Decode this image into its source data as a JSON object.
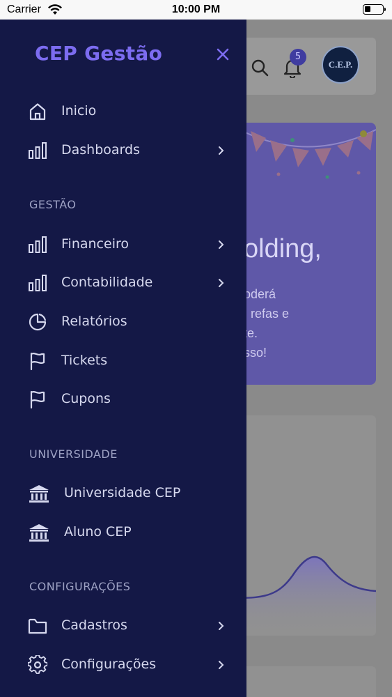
{
  "status_bar": {
    "carrier": "Carrier",
    "time": "10:00 PM",
    "battery_level": 0.35
  },
  "drawer": {
    "title": "CEP Gestão",
    "items_top": [
      {
        "label": "Inicio",
        "icon": "home-icon",
        "chevron": false
      },
      {
        "label": "Dashboards",
        "icon": "bar-chart-icon",
        "chevron": true
      }
    ],
    "sections": [
      {
        "header": "GESTÃO",
        "items": [
          {
            "label": "Financeiro",
            "icon": "bar-chart-icon",
            "chevron": true
          },
          {
            "label": "Contabilidade",
            "icon": "bar-chart-icon",
            "chevron": true
          },
          {
            "label": "Relatórios",
            "icon": "pie-chart-icon",
            "chevron": false
          },
          {
            "label": "Tickets",
            "icon": "flag-icon",
            "chevron": false
          },
          {
            "label": "Cupons",
            "icon": "flag-icon",
            "chevron": false
          }
        ]
      },
      {
        "header": "UNIVERSIDADE",
        "items": [
          {
            "label": "Universidade CEP",
            "icon": "bank-icon",
            "chevron": false
          },
          {
            "label": "Aluno CEP",
            "icon": "bank-icon",
            "chevron": false
          }
        ]
      },
      {
        "header": "CONFIGURAÇÕES",
        "items": [
          {
            "label": "Cadastros",
            "icon": "folder-icon",
            "chevron": true
          },
          {
            "label": "Configurações",
            "icon": "gear-icon",
            "chevron": true
          }
        ]
      }
    ]
  },
  "background": {
    "notification_count": "5",
    "avatar_text": "C.E.P.",
    "banner_title": "olding,",
    "banner_lines": [
      "poderá",
      "refas e",
      "nte.",
      "esso!"
    ]
  },
  "colors": {
    "drawer_bg": "#141846",
    "accent": "#7c6cf0",
    "text": "#d6d8ee",
    "section": "#9ea2c4"
  }
}
